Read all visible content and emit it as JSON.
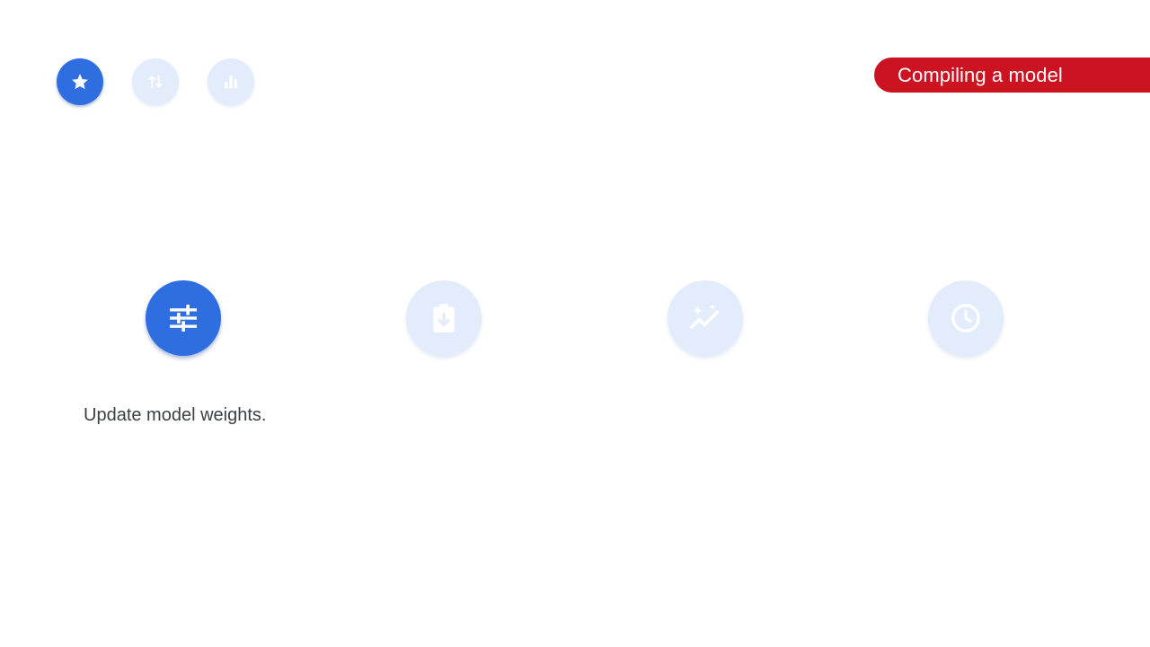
{
  "header": {
    "title": "Compiling a model"
  },
  "top_nav": [
    {
      "icon": "star-icon",
      "state": "active"
    },
    {
      "icon": "sort-arrows-icon",
      "state": "inactive"
    },
    {
      "icon": "bar-chart-icon",
      "state": "inactive"
    }
  ],
  "steps": [
    {
      "icon": "tune-sliders-icon",
      "state": "active",
      "caption": "Update model weights."
    },
    {
      "icon": "clipboard-download-icon",
      "state": "inactive"
    },
    {
      "icon": "sparkle-trend-icon",
      "state": "inactive"
    },
    {
      "icon": "clock-icon",
      "state": "inactive"
    }
  ],
  "colors": {
    "accent_blue": "#2f6ee0",
    "inactive_blue": "#e3ecfb",
    "title_red": "#cc1322",
    "caption_text": "#3c4043"
  }
}
